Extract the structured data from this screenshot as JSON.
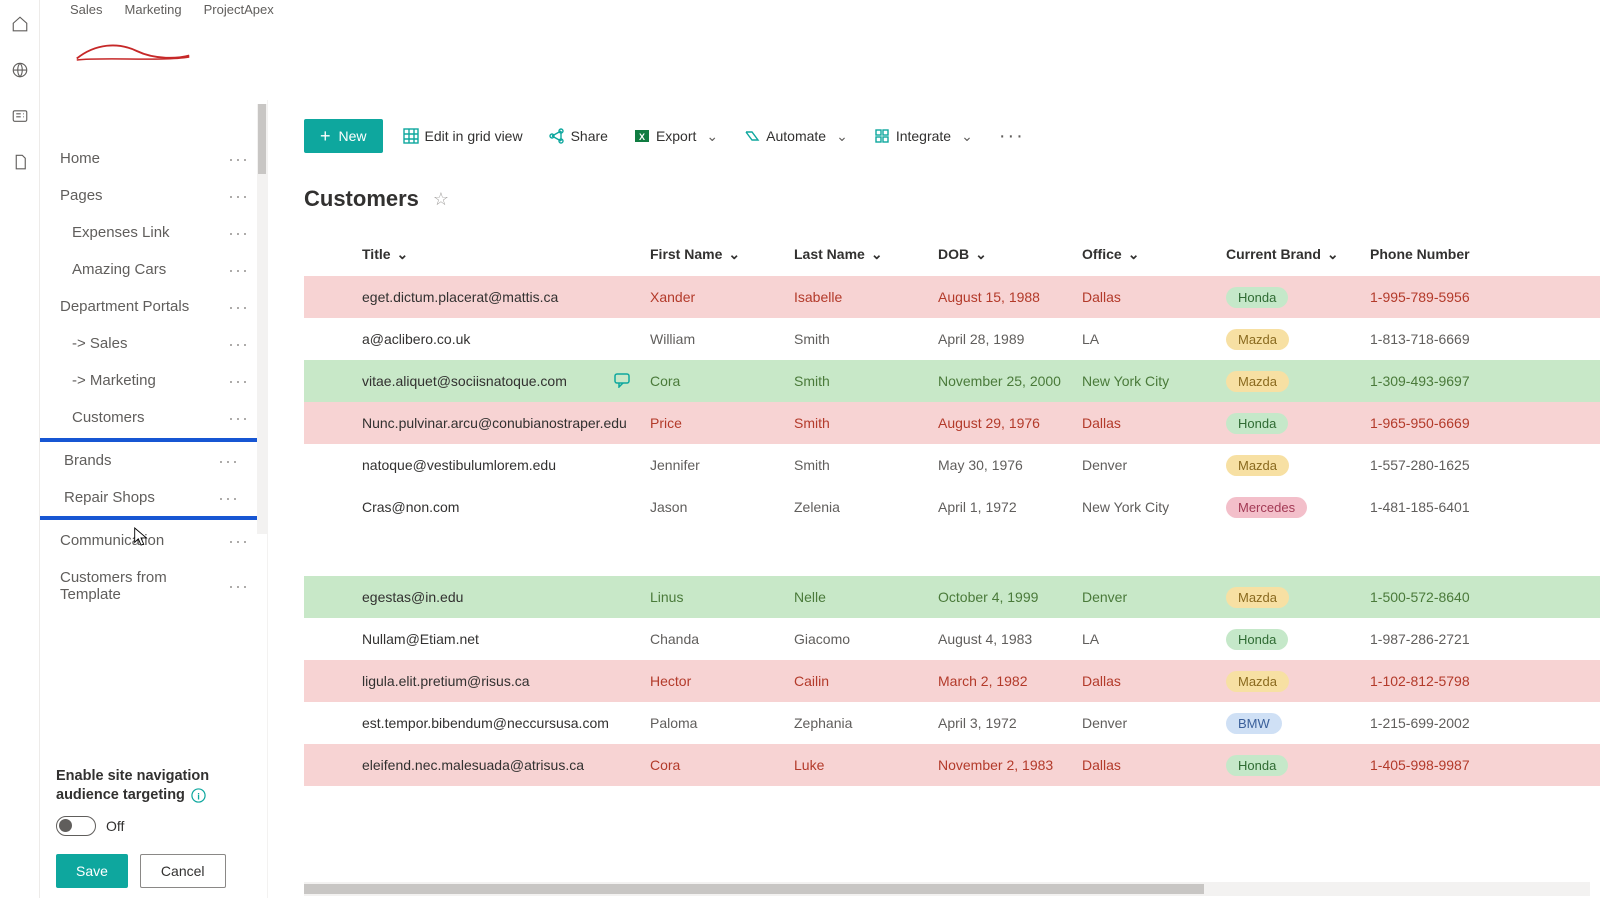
{
  "topTabs": {
    "t0": "Sales",
    "t1": "Marketing",
    "t2": "ProjectApex"
  },
  "sidebar": {
    "home": "Home",
    "pages": "Pages",
    "expenses": "Expenses Link",
    "amazing": "Amazing Cars",
    "dept": "Department Portals",
    "sales": "-> Sales",
    "marketing": "-> Marketing",
    "customers": "Customers",
    "brands": "Brands",
    "repair": "Repair Shops",
    "comm": "Communication",
    "cft": "Customers from Template",
    "targeting_label": "Enable site navigation audience targeting",
    "toggle_state": "Off",
    "save": "Save",
    "cancel": "Cancel"
  },
  "cmd": {
    "new": "New",
    "edit": "Edit in grid view",
    "share": "Share",
    "export": "Export",
    "automate": "Automate",
    "integrate": "Integrate"
  },
  "list": {
    "title": "Customers",
    "cols": {
      "title": "Title",
      "fn": "First Name",
      "ln": "Last Name",
      "dob": "DOB",
      "off": "Office",
      "brand": "Current Brand",
      "phone": "Phone Number"
    }
  },
  "rows": [
    {
      "cls": "pink",
      "title": "eget.dictum.placerat@mattis.ca",
      "fn": "Xander",
      "ln": "Isabelle",
      "dob": "August 15, 1988",
      "off": "Dallas",
      "brand": "Honda",
      "phone": "1-995-789-5956"
    },
    {
      "cls": "plain",
      "title": "a@aclibero.co.uk",
      "fn": "William",
      "ln": "Smith",
      "dob": "April 28, 1989",
      "off": "LA",
      "brand": "Mazda",
      "phone": "1-813-718-6669"
    },
    {
      "cls": "green",
      "title": "vitae.aliquet@sociisnatoque.com",
      "fn": "Cora",
      "ln": "Smith",
      "dob": "November 25, 2000",
      "off": "New York City",
      "brand": "Mazda",
      "phone": "1-309-493-9697",
      "comment": true
    },
    {
      "cls": "pink",
      "title": "Nunc.pulvinar.arcu@conubianostraper.edu",
      "fn": "Price",
      "ln": "Smith",
      "dob": "August 29, 1976",
      "off": "Dallas",
      "brand": "Honda",
      "phone": "1-965-950-6669"
    },
    {
      "cls": "plain",
      "title": "natoque@vestibulumlorem.edu",
      "fn": "Jennifer",
      "ln": "Smith",
      "dob": "May 30, 1976",
      "off": "Denver",
      "brand": "Mazda",
      "phone": "1-557-280-1625"
    },
    {
      "cls": "plain",
      "title": "Cras@non.com",
      "fn": "Jason",
      "ln": "Zelenia",
      "dob": "April 1, 1972",
      "off": "New York City",
      "brand": "Mercedes",
      "phone": "1-481-185-6401"
    }
  ],
  "rows2": [
    {
      "cls": "green",
      "title": "egestas@in.edu",
      "fn": "Linus",
      "ln": "Nelle",
      "dob": "October 4, 1999",
      "off": "Denver",
      "brand": "Mazda",
      "phone": "1-500-572-8640"
    },
    {
      "cls": "plain",
      "title": "Nullam@Etiam.net",
      "fn": "Chanda",
      "ln": "Giacomo",
      "dob": "August 4, 1983",
      "off": "LA",
      "brand": "Honda",
      "phone": "1-987-286-2721"
    },
    {
      "cls": "pink",
      "title": "ligula.elit.pretium@risus.ca",
      "fn": "Hector",
      "ln": "Cailin",
      "dob": "March 2, 1982",
      "off": "Dallas",
      "brand": "Mazda",
      "phone": "1-102-812-5798"
    },
    {
      "cls": "plain",
      "title": "est.tempor.bibendum@neccursusa.com",
      "fn": "Paloma",
      "ln": "Zephania",
      "dob": "April 3, 1972",
      "off": "Denver",
      "brand": "BMW",
      "phone": "1-215-699-2002"
    },
    {
      "cls": "pink",
      "title": "eleifend.nec.malesuada@atrisus.ca",
      "fn": "Cora",
      "ln": "Luke",
      "dob": "November 2, 1983",
      "off": "Dallas",
      "brand": "Honda",
      "phone": "1-405-998-9987"
    }
  ]
}
